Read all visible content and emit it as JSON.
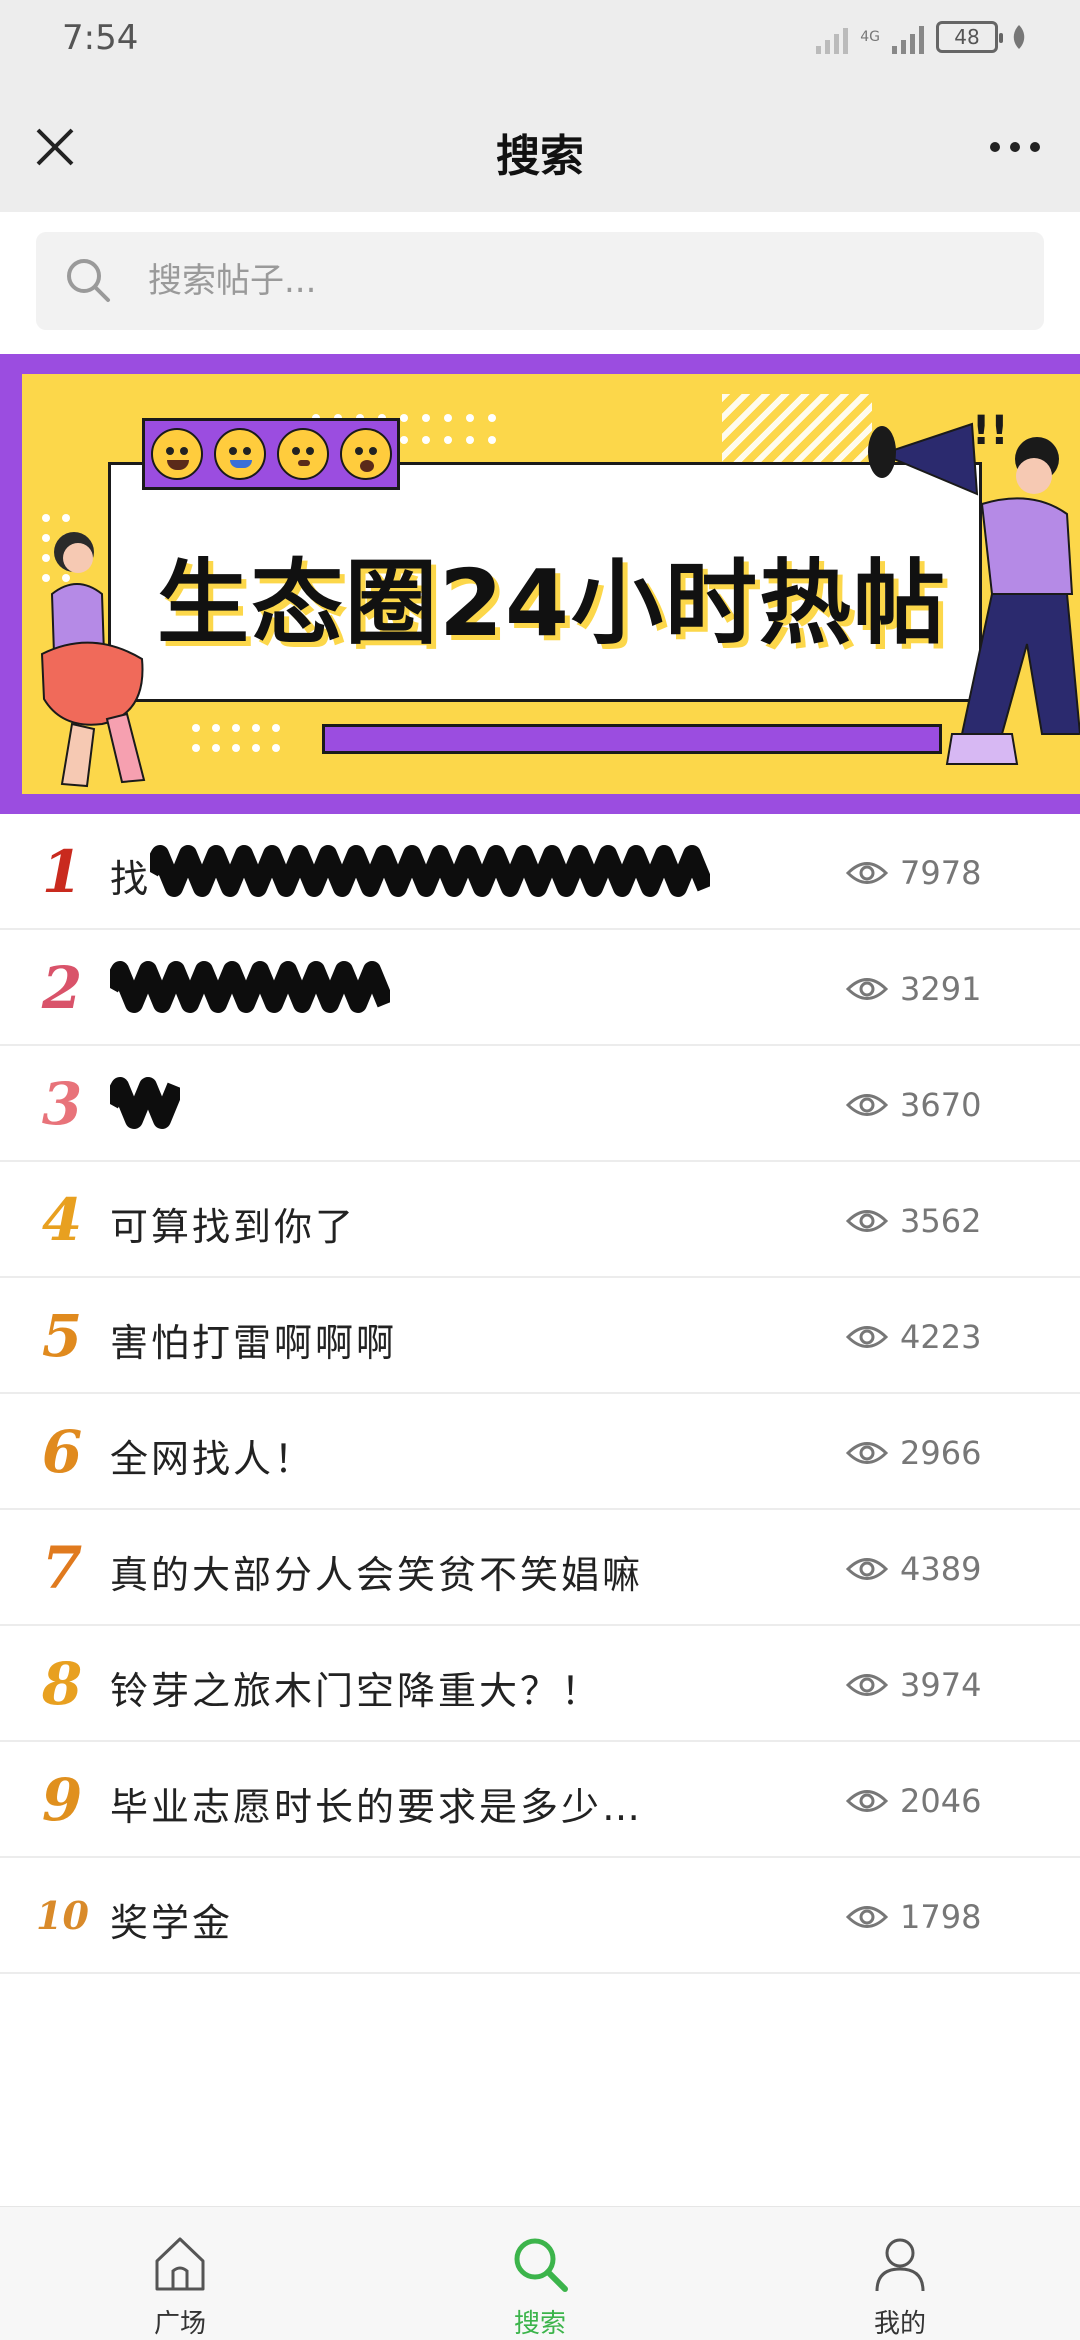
{
  "status_bar": {
    "time": "7:54",
    "battery": "48",
    "network": "4G"
  },
  "nav": {
    "title": "搜索"
  },
  "search": {
    "placeholder": "搜索帖子..."
  },
  "banner": {
    "title": "生态圈24小时热帖",
    "colors": {
      "frame": "#9b4de0",
      "background": "#fcd74a"
    }
  },
  "ranking": [
    {
      "rank": "1",
      "title": "找",
      "views": "7978",
      "color": "#c92a1e",
      "redacted": true
    },
    {
      "rank": "2",
      "title": "",
      "views": "3291",
      "color": "#d9536a",
      "redacted": true
    },
    {
      "rank": "3",
      "title": "",
      "views": "3670",
      "color": "#e8737a",
      "redacted": true
    },
    {
      "rank": "4",
      "title": "可算找到你了",
      "views": "3562",
      "color": "#e8a020",
      "redacted": false
    },
    {
      "rank": "5",
      "title": "害怕打雷啊啊啊",
      "views": "4223",
      "color": "#e08a1e",
      "redacted": false
    },
    {
      "rank": "6",
      "title": "全网找人！",
      "views": "2966",
      "color": "#e08a1e",
      "redacted": false
    },
    {
      "rank": "7",
      "title": "真的大部分人会笑贫不笑娼嘛",
      "views": "4389",
      "color": "#e07a1e",
      "redacted": false
    },
    {
      "rank": "8",
      "title": "铃芽之旅木门空降重大？！",
      "views": "3974",
      "color": "#e8a020",
      "redacted": false
    },
    {
      "rank": "9",
      "title": "毕业志愿时长的要求是多少…",
      "views": "2046",
      "color": "#e0901e",
      "redacted": false
    },
    {
      "rank": "10",
      "title": "奖学金",
      "views": "1798",
      "color": "#d98a2a",
      "redacted": false
    }
  ],
  "tabs": [
    {
      "label": "广场",
      "icon": "home-icon",
      "active": false
    },
    {
      "label": "搜索",
      "icon": "search-icon",
      "active": true
    },
    {
      "label": "我的",
      "icon": "user-icon",
      "active": false
    }
  ],
  "colors": {
    "accent": "#3cb44b",
    "muted": "#777777"
  }
}
